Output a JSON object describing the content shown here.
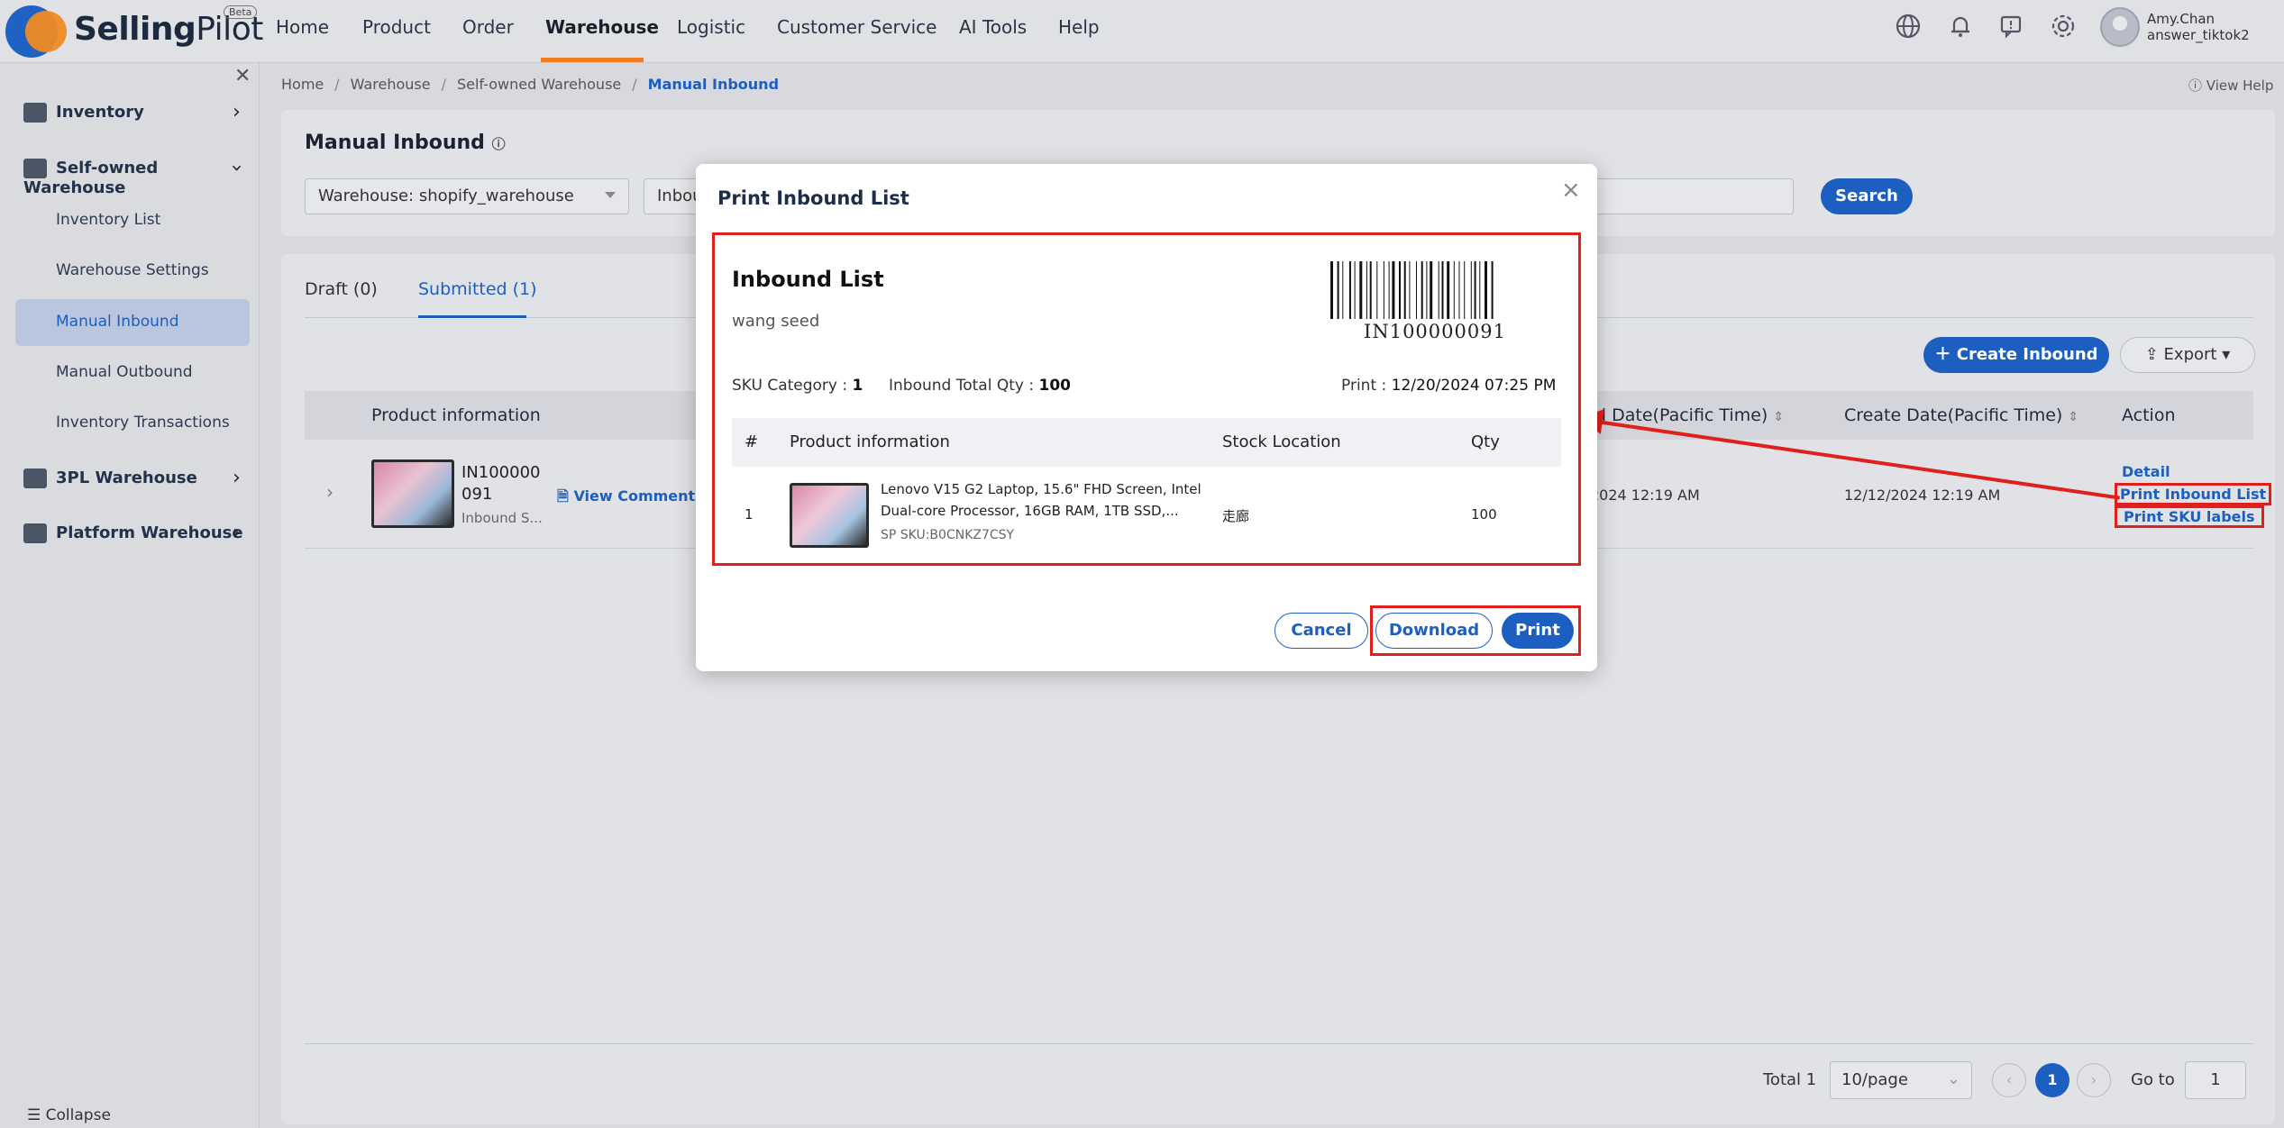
{
  "app": {
    "logo_text_bold": "Selling",
    "logo_text_thin": "Pilot",
    "beta": "Beta"
  },
  "nav": {
    "items": [
      {
        "label": "Home"
      },
      {
        "label": "Product"
      },
      {
        "label": "Order"
      },
      {
        "label": "Warehouse"
      },
      {
        "label": "Logistic"
      },
      {
        "label": "Customer Service"
      },
      {
        "label": "AI Tools"
      },
      {
        "label": "Help"
      }
    ],
    "active": "Warehouse"
  },
  "user": {
    "name": "Amy.Chan",
    "account": "answer_tiktok2"
  },
  "sidebar": {
    "groups": [
      {
        "label": "Inventory"
      },
      {
        "label": "Self-owned Warehouse"
      },
      {
        "label": "3PL Warehouse"
      },
      {
        "label": "Platform Warehouse"
      }
    ],
    "subitems": [
      {
        "label": "Inventory List"
      },
      {
        "label": "Warehouse Settings"
      },
      {
        "label": "Manual Inbound"
      },
      {
        "label": "Manual Outbound"
      },
      {
        "label": "Inventory Transactions"
      }
    ],
    "collapse": "Collapse"
  },
  "breadcrumb": {
    "items": [
      "Home",
      "Warehouse",
      "Self-owned Warehouse",
      "Manual Inbound"
    ]
  },
  "help": "View Help",
  "page": {
    "title": "Manual Inbound",
    "warehouse_select": "Warehouse: shopify_warehouse",
    "second_filter": "Inbou",
    "search_button": "Search",
    "tabs": [
      {
        "label": "Draft (0)"
      },
      {
        "label": "Submitted (1)"
      }
    ],
    "create_button": "Create Inbound",
    "export_button": "Export",
    "columns": {
      "product": "Product information",
      "inbound_date": "nd Date(Pacific Time)",
      "create_date": "Create Date(Pacific Time)",
      "action": "Action"
    },
    "row": {
      "id_line1": "IN100000",
      "id_line2": "091",
      "sub": "Inbound S...",
      "view_comments": "View Comments",
      "inbound_date": "2024 12:19 AM",
      "create_date": "12/12/2024 12:19 AM",
      "actions": [
        "Detail",
        "Print Inbound List",
        "Print SKU labels"
      ]
    },
    "pager": {
      "total": "Total 1",
      "per_page": "10/page",
      "current": "1",
      "goto_label": "Go to",
      "goto_value": "1"
    }
  },
  "modal": {
    "title": "Print Inbound List",
    "list_title": "Inbound List",
    "subtitle": "wang seed",
    "barcode_text": "IN100000091",
    "sku_category_label": "SKU Category :",
    "sku_category_value": "1",
    "total_qty_label": "Inbound Total Qty :",
    "total_qty_value": "100",
    "print_label": "Print :",
    "print_value": "12/20/2024 07:25 PM",
    "columns": [
      "#",
      "Product information",
      "Stock Location",
      "Qty"
    ],
    "item": {
      "index": "1",
      "name_line1": "Lenovo V15 G2 Laptop, 15.6\" FHD Screen, Intel",
      "name_line2": "Dual-core Processor, 16GB RAM, 1TB SSD,...",
      "sku": "SP SKU:B0CNKZ7CSY",
      "location": "走廊",
      "qty": "100"
    },
    "cancel": "Cancel",
    "download": "Download",
    "print": "Print"
  },
  "colors": {
    "primary": "#1d5fc0",
    "accent": "#ef7d22",
    "annotation": "#e0201c"
  }
}
